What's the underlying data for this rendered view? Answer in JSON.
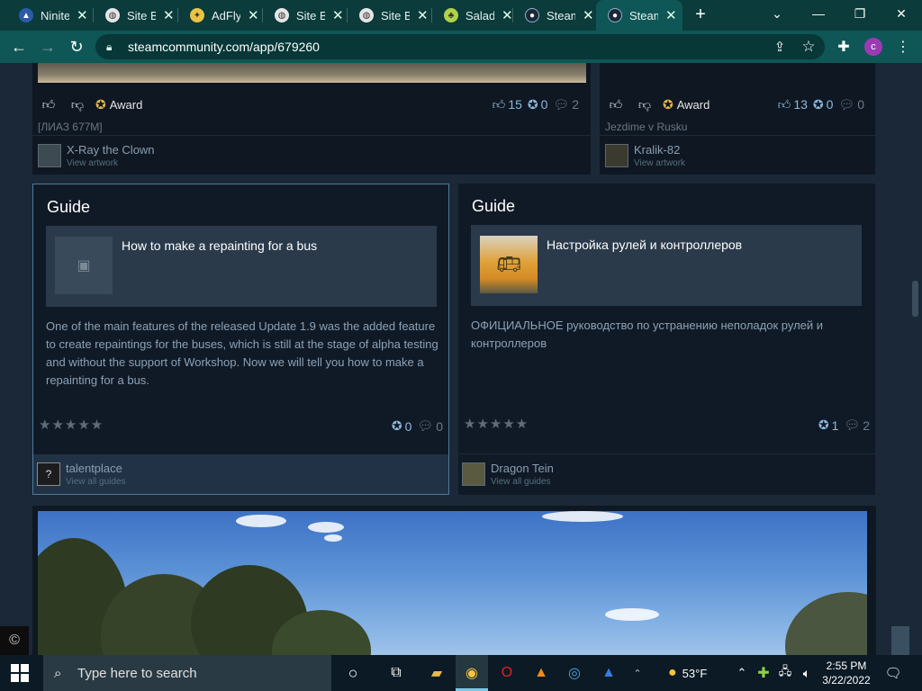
{
  "browser": {
    "tabs": [
      {
        "title": "Ninite",
        "icon": "ninite-icon",
        "color": "#2b5ba8"
      },
      {
        "title": "Site B",
        "icon": "globe-icon",
        "color": "#e6e6e6"
      },
      {
        "title": "AdFly",
        "icon": "adfly-icon",
        "color": "#e9c345"
      },
      {
        "title": "Site B",
        "icon": "globe-icon",
        "color": "#e6e6e6"
      },
      {
        "title": "Site B",
        "icon": "globe-icon",
        "color": "#e6e6e6"
      },
      {
        "title": "Salad",
        "icon": "salad-icon",
        "color": "#b0d14a"
      },
      {
        "title": "Steam",
        "icon": "steam-icon",
        "color": "#1b2838"
      },
      {
        "title": "Steam",
        "icon": "steam-icon",
        "color": "#1b2838"
      }
    ],
    "url": "steamcommunity.com/app/679260",
    "profile_initial": "c"
  },
  "artwork_cards": [
    {
      "award_label": "Award",
      "likes": "15",
      "awards": "0",
      "comments": "2",
      "title": "[ЛИАЗ 677М]",
      "author": "X-Ray the Clown",
      "author_link": "View artwork"
    },
    {
      "award_label": "Award",
      "likes": "13",
      "awards": "0",
      "comments": "0",
      "title": "Jezdime v Rusku",
      "author": "Kralik-82",
      "author_link": "View artwork"
    }
  ],
  "guides": [
    {
      "header": "Guide",
      "title": "How to make a repainting for a bus",
      "description": "One of the main features of the released Update 1.9 was the added feature to create repaintings for the buses, which is still at the stage of alpha testing and without the support of Workshop. Now we will tell you how to make a repainting for a bus.",
      "stars": "★★★★★",
      "awards": "0",
      "comments": "0",
      "author": "talentplace",
      "author_link": "View all guides"
    },
    {
      "header": "Guide",
      "title": "Настройка рулей и контроллеров",
      "description": "ОФИЦИАЛЬНОЕ руководство по устранению неполадок рулей и контроллеров",
      "stars": "★★★★★",
      "awards": "1",
      "comments": "2",
      "author": "Dragon Tein",
      "author_link": "View all guides"
    }
  ],
  "page": {
    "copyright_symbol": "©"
  },
  "taskbar": {
    "search_placeholder": "Type here to search",
    "weather": "53°F",
    "time": "2:55 PM",
    "date": "3/22/2022"
  }
}
